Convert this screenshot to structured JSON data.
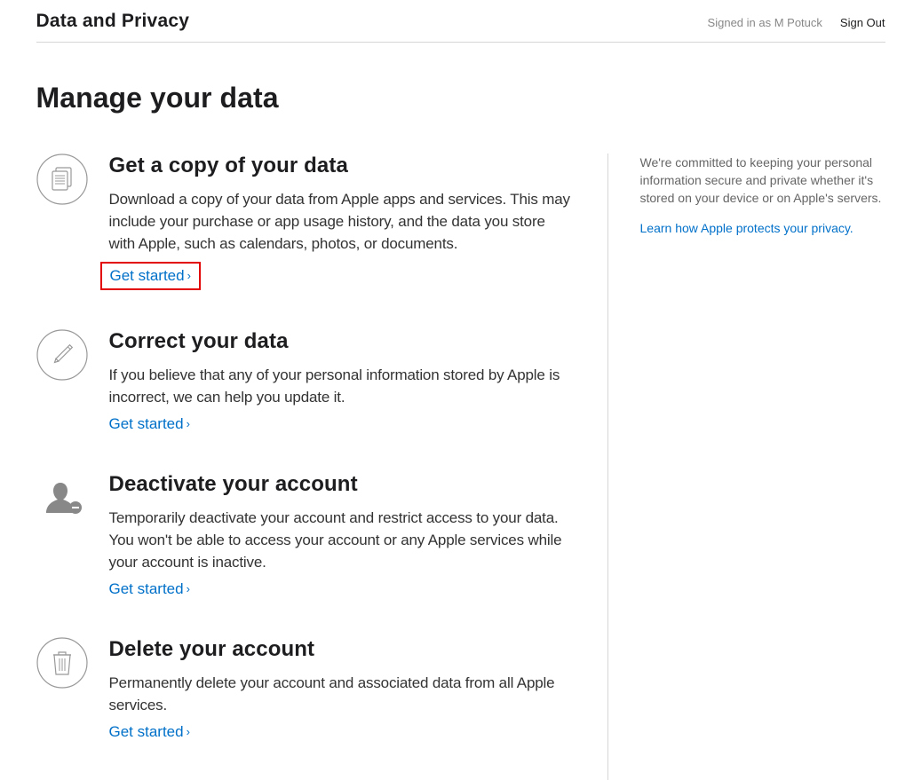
{
  "header": {
    "title": "Data and Privacy",
    "signedIn": "Signed in as M Potuck",
    "signOut": "Sign Out"
  },
  "pageTitle": "Manage your data",
  "options": [
    {
      "title": "Get a copy of your data",
      "desc": "Download a copy of your data from Apple apps and services. This may include your purchase or app usage history, and the data you store with Apple, such as calendars, photos, or documents.",
      "cta": "Get started"
    },
    {
      "title": "Correct your data",
      "desc": "If you believe that any of your personal information stored by Apple is incorrect, we can help you update it.",
      "cta": "Get started"
    },
    {
      "title": "Deactivate your account",
      "desc": "Temporarily deactivate your account and restrict access to your data. You won't be able to access your account or any Apple services while your account is inactive.",
      "cta": "Get started"
    },
    {
      "title": "Delete your account",
      "desc": "Permanently delete your account and associated data from all Apple services.",
      "cta": "Get started"
    }
  ],
  "sidebar": {
    "text": "We're committed to keeping your personal information secure and private whether it's stored on your device or on Apple's servers.",
    "link": "Learn how Apple protects your privacy."
  }
}
